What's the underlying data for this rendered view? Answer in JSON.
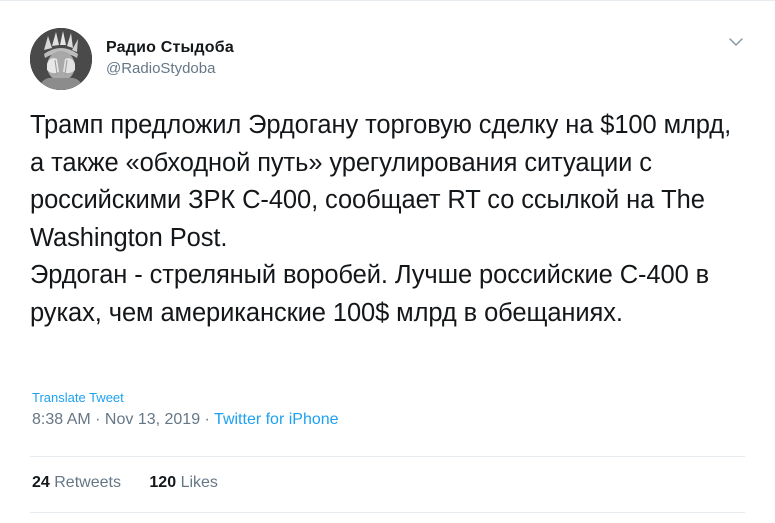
{
  "user": {
    "display_name": "Радио Стыдоба",
    "handle": "@RadioStydoba",
    "avatar_icon": "statue-of-liberty-facepalm-avatar"
  },
  "tweet": {
    "paragraph_1": "Трамп предложил Эрдогану торговую сделку на $100 млрд, а также «обходной путь» урегулирования ситуации с российскими ЗРК С-400, сообщает RT со ссылкой на The Washington Post.",
    "paragraph_2": "Эрдоган - стреляный воробей. Лучше российские С-400 в руках, чем американские 100$ млрд в обещаниях."
  },
  "translate_label": "Translate Tweet",
  "meta": {
    "time": "8:38 AM",
    "separator": " · ",
    "date": "Nov 13, 2019",
    "source": "Twitter for iPhone"
  },
  "stats": {
    "retweets_count": "24",
    "retweets_label": "Retweets",
    "likes_count": "120",
    "likes_label": "Likes"
  },
  "colors": {
    "link": "#1da1f2",
    "secondary_text": "#657786",
    "primary_text": "#14171a",
    "divider": "#e6ecf0"
  }
}
